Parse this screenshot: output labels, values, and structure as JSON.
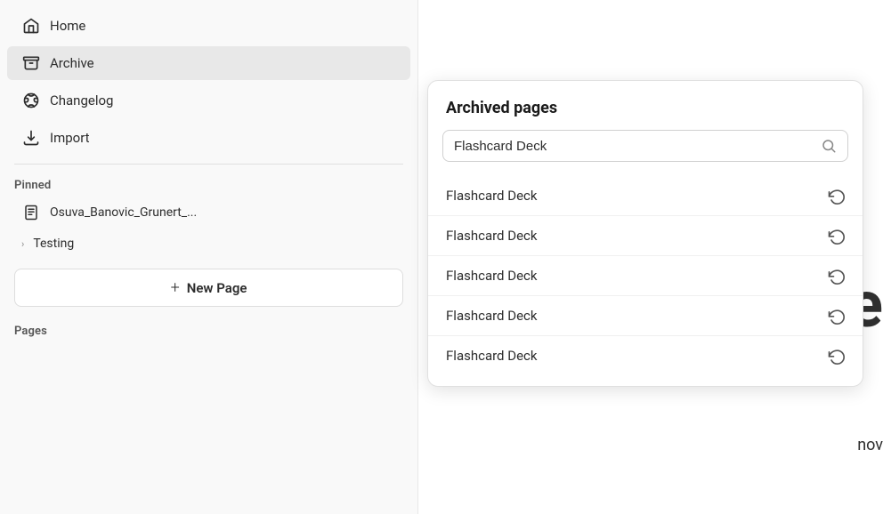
{
  "sidebar": {
    "nav_items": [
      {
        "id": "home",
        "label": "Home"
      },
      {
        "id": "archive",
        "label": "Archive"
      },
      {
        "id": "changelog",
        "label": "Changelog"
      },
      {
        "id": "import",
        "label": "Import"
      }
    ],
    "pinned_section_label": "Pinned",
    "pinned_items": [
      {
        "id": "doc1",
        "label": "Osuva_Banovic_Grunert_...",
        "type": "document"
      },
      {
        "id": "testing",
        "label": "Testing",
        "type": "folder"
      }
    ],
    "new_page_label": "New Page",
    "pages_section_label": "Pages"
  },
  "archive_popup": {
    "title": "Archived pages",
    "search_value": "Flashcard Deck",
    "search_placeholder": "Search...",
    "items": [
      {
        "id": 1,
        "name": "Flashcard Deck"
      },
      {
        "id": 2,
        "name": "Flashcard Deck"
      },
      {
        "id": 3,
        "name": "Flashcard Deck"
      },
      {
        "id": 4,
        "name": "Flashcard Deck"
      },
      {
        "id": 5,
        "name": "Flashcard Deck"
      }
    ]
  },
  "partial_text": {
    "letter": "e",
    "bottom_text": "nov"
  }
}
